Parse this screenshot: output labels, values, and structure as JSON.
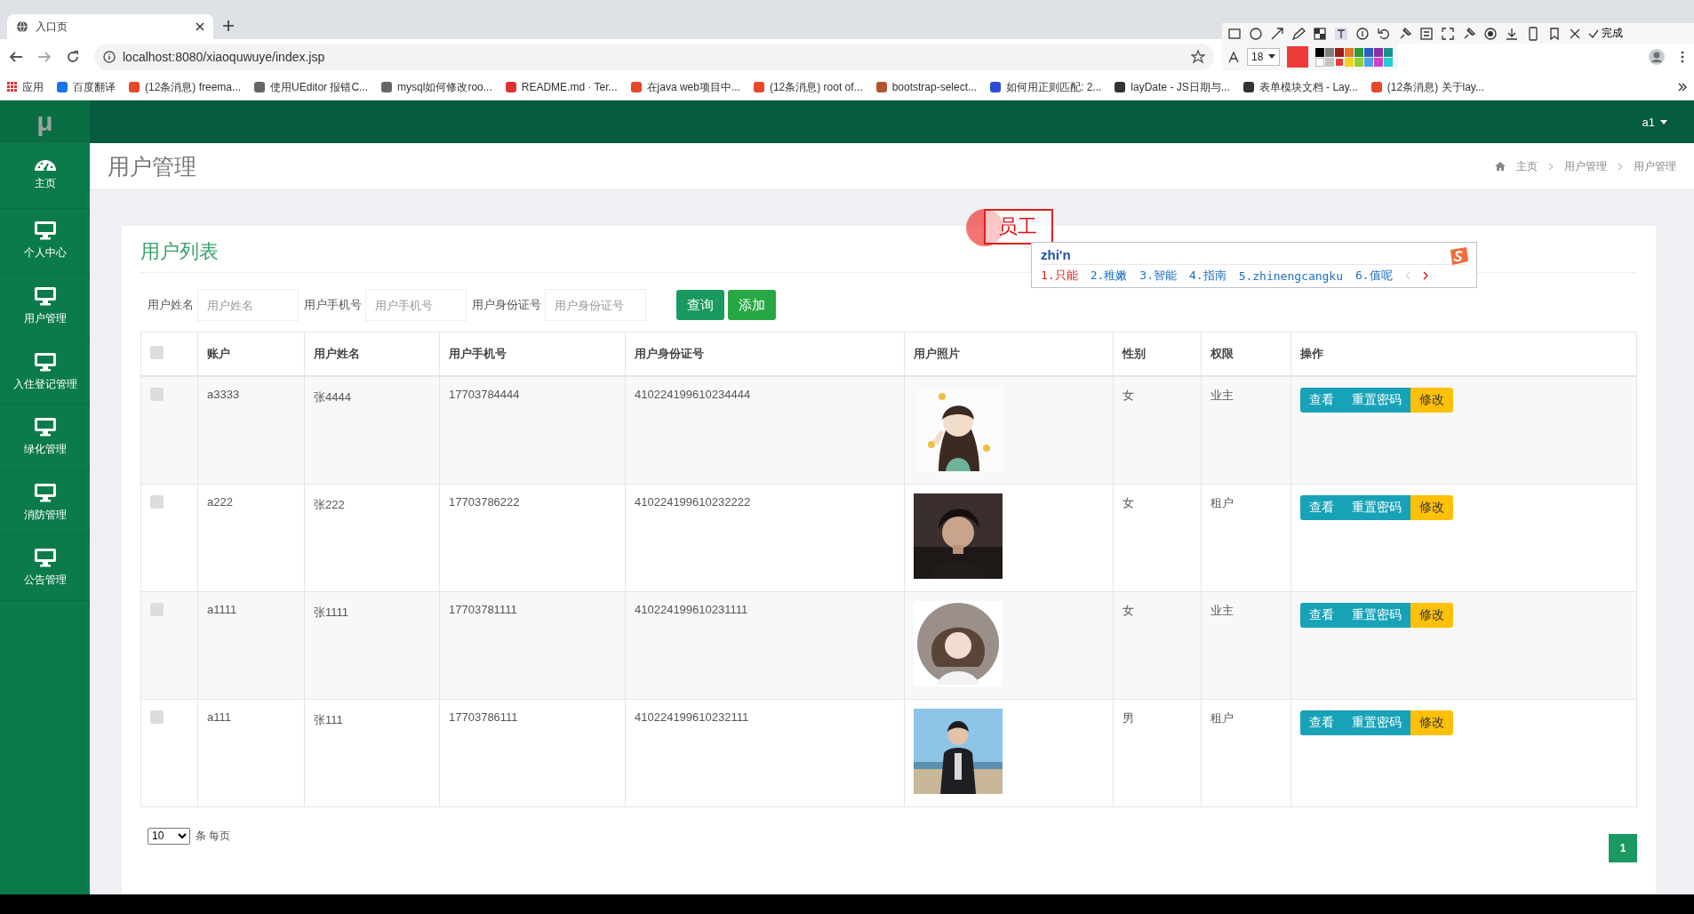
{
  "browser": {
    "tab_title": "入口页",
    "url": "localhost:8080/xiaoquwuye/index.jsp",
    "bookmarks": [
      "应用",
      "百度翻译",
      "(12条消息) freema...",
      "使用UEditor 报错C...",
      "mysql如何修改roo...",
      "README.md · Ter...",
      "在java web项目中...",
      "(12条消息) root of...",
      "bootstrap-select...",
      "如何用正则匹配: 2...",
      "layDate - JS日期与...",
      "表单模块文档 - Lay...",
      "(12条消息) 关于lay..."
    ]
  },
  "capture_toolbar": {
    "done": "完成",
    "font_size": "18",
    "swatches": [
      {
        "color": "#000000",
        "selected": false
      },
      {
        "color": "#7f7f7f",
        "selected": false
      },
      {
        "color": "#9c1a1a",
        "selected": false
      },
      {
        "color": "#e8742a",
        "selected": false
      },
      {
        "color": "#2e9a3a",
        "selected": false
      },
      {
        "color": "#2a5fc9",
        "selected": false
      },
      {
        "color": "#8a2fa8",
        "selected": false
      },
      {
        "color": "#16938f",
        "selected": false
      },
      {
        "color": "#ffffff",
        "selected": false
      },
      {
        "color": "#c3c3c3",
        "selected": false
      },
      {
        "color": "#f03a3a",
        "selected": true
      },
      {
        "color": "#f4d21c",
        "selected": false
      },
      {
        "color": "#8fd12e",
        "selected": false
      },
      {
        "color": "#4aa0ee",
        "selected": false
      },
      {
        "color": "#d03fd0",
        "selected": false
      },
      {
        "color": "#1fd0d0",
        "selected": false
      }
    ]
  },
  "annotation": {
    "text": "员工"
  },
  "ime": {
    "input": "zhi'n",
    "candidates": [
      {
        "text": "1.只能",
        "selected": true
      },
      {
        "text": "2.稚嫩",
        "selected": false
      },
      {
        "text": "3.智能",
        "selected": false
      },
      {
        "text": "4.指南",
        "selected": false
      },
      {
        "text": "5.zhinengcangku",
        "selected": false
      },
      {
        "text": "6.值呢",
        "selected": false
      }
    ]
  },
  "app": {
    "logo": "μ",
    "user": "a1",
    "sidebar": [
      {
        "label": "主页",
        "kind": "dashboard"
      },
      {
        "label": "个人中心",
        "kind": "monitor"
      },
      {
        "label": "用户管理",
        "kind": "monitor"
      },
      {
        "label": "入住登记管理",
        "kind": "monitor"
      },
      {
        "label": "绿化管理",
        "kind": "monitor"
      },
      {
        "label": "消防管理",
        "kind": "monitor"
      },
      {
        "label": "公告管理",
        "kind": "monitor"
      }
    ],
    "page_title": "用户管理",
    "breadcrumb": [
      "主页",
      "用户管理",
      "用户管理"
    ],
    "card_title": "用户列表",
    "filters": [
      {
        "label": "用户姓名",
        "placeholder": "用户姓名"
      },
      {
        "label": "用户手机号",
        "placeholder": "用户手机号"
      },
      {
        "label": "用户身份证号",
        "placeholder": "用户身份证号"
      }
    ],
    "filter_buttons": [
      {
        "label": "查询",
        "kind": "search"
      },
      {
        "label": "添加",
        "kind": "add"
      }
    ],
    "table": {
      "select_all": {
        "checked": false
      },
      "columns": [
        "账户",
        "用户姓名",
        "用户手机号",
        "用户身份证号",
        "用户照片",
        "性别",
        "权限",
        "操作"
      ],
      "rows": [
        {
          "checked": false,
          "account": "a3333",
          "name": "张4444",
          "phone": "17703784444",
          "id_number": "410224199610234444",
          "gender": "女",
          "role": "业主",
          "actions": [
            "查看",
            "重置密码",
            "修改"
          ]
        },
        {
          "checked": false,
          "account": "a222",
          "name": "张222",
          "phone": "17703786222",
          "id_number": "410224199610232222",
          "gender": "女",
          "role": "租户",
          "actions": [
            "查看",
            "重置密码",
            "修改"
          ]
        },
        {
          "checked": false,
          "account": "a1111",
          "name": "张1111",
          "phone": "17703781111",
          "id_number": "410224199610231111",
          "gender": "女",
          "role": "业主",
          "actions": [
            "查看",
            "重置密码",
            "修改"
          ]
        },
        {
          "checked": false,
          "account": "a111",
          "name": "张111",
          "phone": "17703786111",
          "id_number": "410224199610232111",
          "gender": "男",
          "role": "租户",
          "actions": [
            "查看",
            "重置密码",
            "修改"
          ]
        }
      ]
    },
    "pagination": {
      "page_size": "10",
      "page_size_label": "条 每页",
      "pages": [
        {
          "label": "1",
          "selected": true
        }
      ]
    }
  }
}
